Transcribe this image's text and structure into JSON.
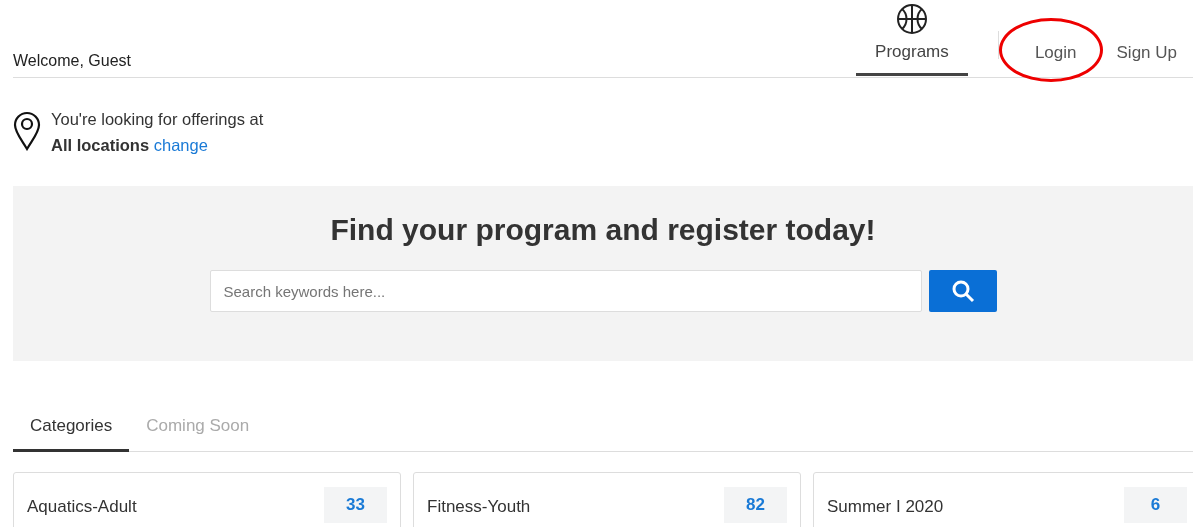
{
  "header": {
    "welcome": "Welcome, Guest",
    "nav": [
      {
        "kind": "icon-tab",
        "label": "Programs",
        "selected": true,
        "circled": false
      },
      {
        "kind": "link",
        "label": "Login",
        "selected": false,
        "circled": true
      },
      {
        "kind": "link",
        "label": "Sign Up",
        "selected": false,
        "circled": false
      }
    ]
  },
  "location": {
    "line1": "You're looking for offerings at",
    "place": "All locations",
    "link": "change"
  },
  "banner": {
    "heading": "Find your program and register today!",
    "search": {
      "placeholder": "Search keywords here..."
    }
  },
  "tabs": [
    {
      "label": "Categories",
      "selected": true
    },
    {
      "label": "Coming Soon",
      "selected": false
    }
  ],
  "categories": [
    {
      "name": "Aquatics-Adult",
      "count": "33"
    },
    {
      "name": "Fitness-Youth",
      "count": "82"
    },
    {
      "name": "Summer I 2020",
      "count": "6"
    }
  ]
}
